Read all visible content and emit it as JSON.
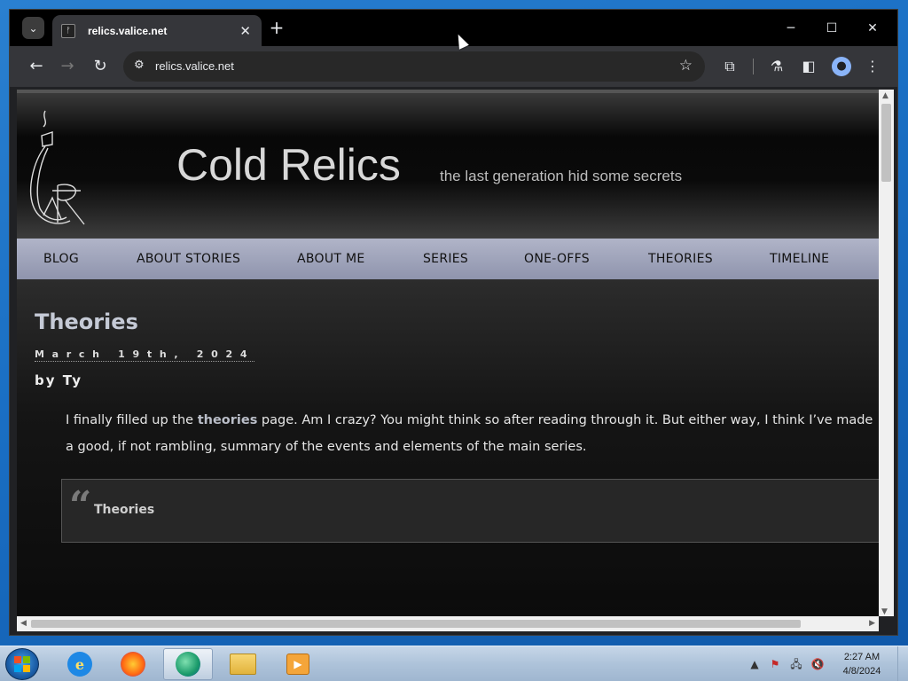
{
  "browser": {
    "tab_title": "relics.valice.net",
    "url": "relics.valice.net",
    "tab_search_icon": "chevron-down-icon",
    "new_tab_icon": "plus-icon",
    "window_controls": {
      "minimize": "─",
      "maximize": "☐",
      "close": "✕"
    }
  },
  "site": {
    "title": "Cold Relics",
    "tagline": "the last generation hid some secrets",
    "nav": [
      "BLOG",
      "ABOUT STORIES",
      "ABOUT ME",
      "SERIES",
      "ONE-OFFS",
      "THEORIES",
      "TIMELINE"
    ]
  },
  "post": {
    "title": "Theories",
    "date": "March 19th, 2024",
    "author": "by Ty",
    "body_before": "I finally filled up the ",
    "body_link": "theories",
    "body_after": " page. Am I crazy? You might think so after reading through it. But either way, I think I’ve made a good, if not rambling, summary of the events and elements of the main series.",
    "embed_title": "Theories"
  },
  "taskbar": {
    "apps": [
      "internet-explorer",
      "firefox",
      "chrome-like-browser",
      "file-explorer",
      "media-player"
    ],
    "clock_time": "2:27 AM",
    "clock_date": "4/8/2024"
  },
  "colors": {
    "nav_bg": "#a3a7bd",
    "link": "#b9bdc7",
    "title": "#c5cad6"
  }
}
